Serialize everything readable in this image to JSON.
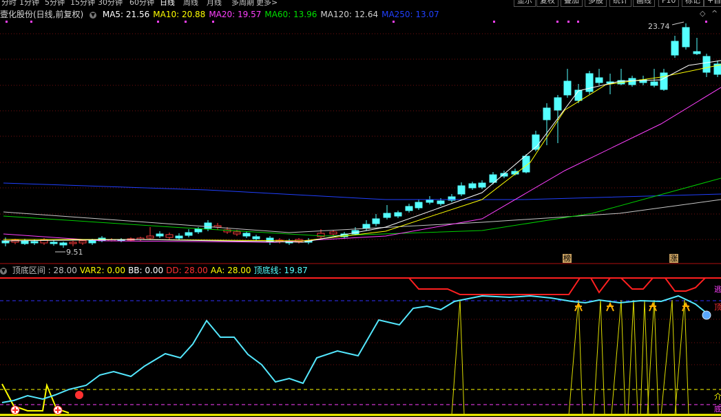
{
  "toolbar": {
    "periods": [
      {
        "label": "分时",
        "active": false
      },
      {
        "label": "1分钟",
        "active": false
      },
      {
        "label": "5分钟",
        "active": false
      },
      {
        "label": "15分钟",
        "active": false
      },
      {
        "label": "30分钟",
        "active": false
      },
      {
        "label": "60分钟",
        "active": false
      },
      {
        "label": "日线",
        "active": true
      },
      {
        "label": "周线",
        "active": false
      },
      {
        "label": "月线",
        "active": false
      },
      {
        "label": "多周期",
        "active": false
      },
      {
        "label": "更多>",
        "active": false
      }
    ],
    "buttons": [
      "显示",
      "复权",
      "叠加",
      "多股",
      "统计",
      "画线",
      "F10",
      "标记",
      "+自"
    ]
  },
  "main": {
    "stock_label": "壹化股份(日线,前复权)",
    "indicators": [
      {
        "label": "MA5: 21.56",
        "color": "#ffffff"
      },
      {
        "label": "MA10: 20.88",
        "color": "#ffff00"
      },
      {
        "label": "MA20: 19.57",
        "color": "#ff40ff"
      },
      {
        "label": "MA60: 13.96",
        "color": "#00e000"
      },
      {
        "label": "MA120: 12.64",
        "color": "#d0d0d0"
      },
      {
        "label": "MA250: 13.07",
        "color": "#2040ff"
      }
    ],
    "high_label": "23.74",
    "low_label": "9.51",
    "badges": [
      "榜",
      "涨"
    ],
    "colors": {
      "up": "#ff3c3c",
      "down": "#54ffff",
      "grid": "#7a1010"
    }
  },
  "sub": {
    "indicators": [
      {
        "label": "顶底区间 : 28.00",
        "color": "#c0c0c0"
      },
      {
        "label": "VAR2: 0.00",
        "color": "#ffff00"
      },
      {
        "label": "BB: 0.00",
        "color": "#ffffff"
      },
      {
        "label": "DD: 28.00",
        "color": "#ff3030"
      },
      {
        "label": "AA: 28.00",
        "color": "#ffff00"
      },
      {
        "label": "顶底线: 19.87",
        "color": "#54ffff"
      }
    ],
    "right_marks": [
      "逃",
      "顶",
      "介",
      "底"
    ]
  }
}
